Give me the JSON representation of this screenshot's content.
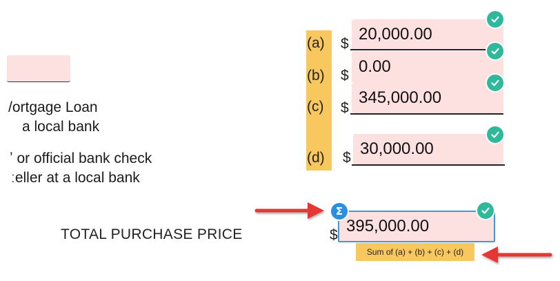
{
  "left": {
    "line1": "/ortgage Loan",
    "line2": "a local bank",
    "line3": "ʼ or official bank check",
    "line4": "ːeller at a local bank"
  },
  "rows": [
    {
      "letter": "(a)",
      "dollar": "$",
      "value": "20,000.00"
    },
    {
      "letter": "(b)",
      "dollar": "$",
      "value": "0.00"
    },
    {
      "letter": "(c)",
      "dollar": "$",
      "value": "345,000.00"
    },
    {
      "letter": "(d)",
      "dollar": "$",
      "value": "30,000.00"
    }
  ],
  "total": {
    "label": "TOTAL PURCHASE PRICE",
    "dollar": "$",
    "value": "395,000.00",
    "formula_note": "Sum of (a) + (b) + (c) + (d)",
    "formula_icon": "Σ"
  },
  "icons": {
    "valid": "check-circle-icon",
    "formula": "sigma-icon",
    "annotation": "arrow-icon"
  },
  "colors": {
    "field_bg": "#fde0e0",
    "letter_bg": "#f8c75e",
    "check": "#2fb99a",
    "selected_border": "#3b9ad9",
    "arrow": "#e53935"
  }
}
